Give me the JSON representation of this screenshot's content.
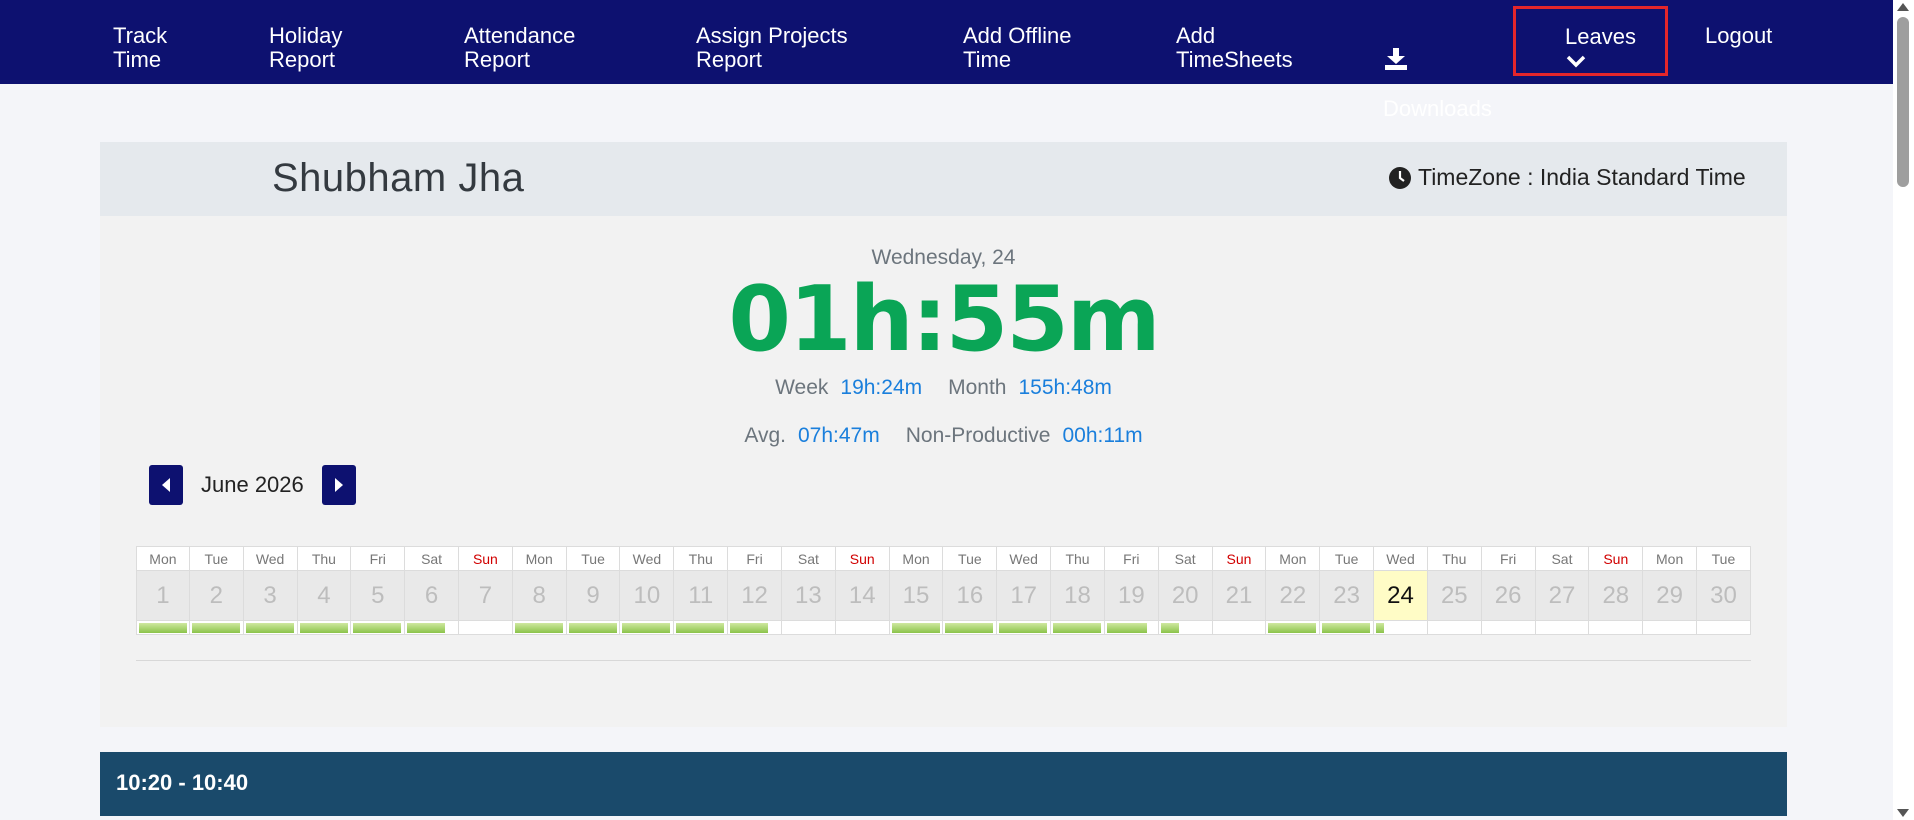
{
  "nav": {
    "items": [
      {
        "label": "Track\nTime"
      },
      {
        "label": "Holiday\nReport"
      },
      {
        "label": "Attendance\nReport"
      },
      {
        "label": "Assign Projects\nReport"
      },
      {
        "label": "Add Offline\nTime"
      },
      {
        "label": "Add\nTimeSheets"
      },
      {
        "label": "Downloads",
        "icon": "download-icon"
      },
      {
        "label": "Leaves",
        "icon": "chevron-down-icon"
      },
      {
        "label": "Logout"
      }
    ]
  },
  "header": {
    "user_name": "Shubham Jha",
    "timezone": "TimeZone : India Standard Time"
  },
  "summary": {
    "date": "Wednesday, 24",
    "today_time": "01h:55m",
    "week_label": "Week",
    "week_value": "19h:24m",
    "month_label": "Month",
    "month_value": "155h:48m",
    "avg_label": "Avg.",
    "avg_value": "07h:47m",
    "nonprod_label": "Non-Productive",
    "nonprod_value": "00h:11m"
  },
  "calendar": {
    "month_label": "June 2026",
    "days": [
      {
        "name": "Mon",
        "num": "1",
        "progress": 0.95
      },
      {
        "name": "Tue",
        "num": "2",
        "progress": 0.95
      },
      {
        "name": "Wed",
        "num": "3",
        "progress": 0.95
      },
      {
        "name": "Thu",
        "num": "4",
        "progress": 0.95
      },
      {
        "name": "Fri",
        "num": "5",
        "progress": 0.95
      },
      {
        "name": "Sat",
        "num": "6",
        "progress": 0.75
      },
      {
        "name": "Sun",
        "num": "7",
        "progress": 0
      },
      {
        "name": "Mon",
        "num": "8",
        "progress": 0.95
      },
      {
        "name": "Tue",
        "num": "9",
        "progress": 0.95
      },
      {
        "name": "Wed",
        "num": "10",
        "progress": 0.95
      },
      {
        "name": "Thu",
        "num": "11",
        "progress": 0.95
      },
      {
        "name": "Fri",
        "num": "12",
        "progress": 0.75
      },
      {
        "name": "Sat",
        "num": "13",
        "progress": 0
      },
      {
        "name": "Sun",
        "num": "14",
        "progress": 0
      },
      {
        "name": "Mon",
        "num": "15",
        "progress": 0.95
      },
      {
        "name": "Tue",
        "num": "16",
        "progress": 0.95
      },
      {
        "name": "Wed",
        "num": "17",
        "progress": 0.95
      },
      {
        "name": "Thu",
        "num": "18",
        "progress": 0.95
      },
      {
        "name": "Fri",
        "num": "19",
        "progress": 0.8
      },
      {
        "name": "Sat",
        "num": "20",
        "progress": 0.35
      },
      {
        "name": "Sun",
        "num": "21",
        "progress": 0
      },
      {
        "name": "Mon",
        "num": "22",
        "progress": 0.95
      },
      {
        "name": "Tue",
        "num": "23",
        "progress": 0.95
      },
      {
        "name": "Wed",
        "num": "24",
        "progress": 0.15,
        "today": true
      },
      {
        "name": "Thu",
        "num": "25",
        "progress": 0
      },
      {
        "name": "Fri",
        "num": "26",
        "progress": 0
      },
      {
        "name": "Sat",
        "num": "27",
        "progress": 0
      },
      {
        "name": "Sun",
        "num": "28",
        "progress": 0
      },
      {
        "name": "Mon",
        "num": "29",
        "progress": 0
      },
      {
        "name": "Tue",
        "num": "30",
        "progress": 0
      }
    ]
  },
  "timeslot": {
    "label": "10:20 - 10:40"
  },
  "colors": {
    "nav_bg": "#0d1170",
    "time_green": "#0aa556",
    "value_blue": "#1a7fdc",
    "sunday_red": "#d10000",
    "highlight_red": "#e3262b",
    "slot_bg": "#1a4a6b"
  }
}
